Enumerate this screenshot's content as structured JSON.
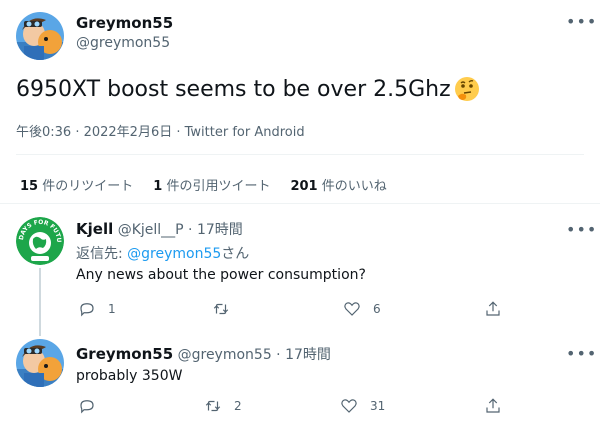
{
  "main_tweet": {
    "display_name": "Greymon55",
    "handle": "@greymon55",
    "text": "6950XT boost seems to be over 2.5Ghz",
    "emoji_icon": "thinking-face-icon",
    "meta": "午後0:36 · 2022年2月6日 · Twitter for Android"
  },
  "stats": {
    "retweets_count": "15",
    "retweets_label": "件のリツイート",
    "quotes_count": "1",
    "quotes_label": "件の引用ツイート",
    "likes_count": "201",
    "likes_label": "件のいいね"
  },
  "reply1": {
    "display_name": "Kjell",
    "handle_time": "@Kjell__P · 17時間",
    "reply_prefix": "返信先: ",
    "reply_target": "@greymon55",
    "reply_suffix": "さん",
    "text": "Any news about the power consumption?",
    "avatar_text": "FRIDAYS FOR FUTURE",
    "avatar_subtext": "Parlic",
    "counts": {
      "reply": "1",
      "retweet": "",
      "like": "6"
    }
  },
  "reply2": {
    "display_name": "Greymon55",
    "handle_time": "@greymon55 · 17時間",
    "text": "probably 350W",
    "counts": {
      "reply": "",
      "retweet": "2",
      "like": "31"
    }
  },
  "colors": {
    "accent": "#1d9bf0",
    "muted": "#536471",
    "divider": "#eff3f4"
  }
}
